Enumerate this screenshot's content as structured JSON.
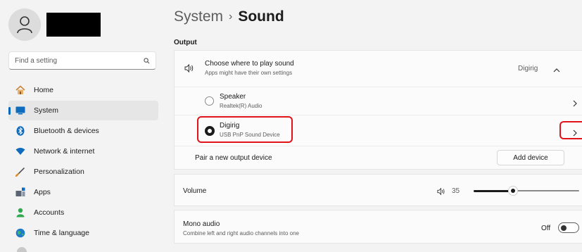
{
  "sidebar": {
    "search_placeholder": "Find a setting",
    "items": [
      {
        "label": "Home",
        "icon": "home-icon"
      },
      {
        "label": "System",
        "icon": "system-icon",
        "active": true
      },
      {
        "label": "Bluetooth & devices",
        "icon": "bluetooth-icon"
      },
      {
        "label": "Network & internet",
        "icon": "wifi-icon"
      },
      {
        "label": "Personalization",
        "icon": "brush-icon"
      },
      {
        "label": "Apps",
        "icon": "apps-icon"
      },
      {
        "label": "Accounts",
        "icon": "person-icon"
      },
      {
        "label": "Time & language",
        "icon": "globe-icon"
      }
    ]
  },
  "header": {
    "crumb": "System",
    "separator": "›",
    "current": "Sound"
  },
  "output": {
    "section_label": "Output",
    "choose_title": "Choose where to play sound",
    "choose_subtitle": "Apps might have their own settings",
    "choose_value": "Digirig",
    "devices": [
      {
        "name": "Speaker",
        "desc": "Realtek(R) Audio",
        "selected": false
      },
      {
        "name": "Digirig",
        "desc": "USB PnP Sound Device",
        "selected": true
      }
    ],
    "pair_label": "Pair a new output device",
    "add_device_label": "Add device"
  },
  "volume": {
    "label": "Volume",
    "value": "35",
    "level": 0.35
  },
  "mono": {
    "title": "Mono audio",
    "subtitle": "Combine left and right audio channels into one",
    "state": "Off"
  },
  "colors": {
    "accent": "#0067c0",
    "highlight": "#e0131b"
  }
}
